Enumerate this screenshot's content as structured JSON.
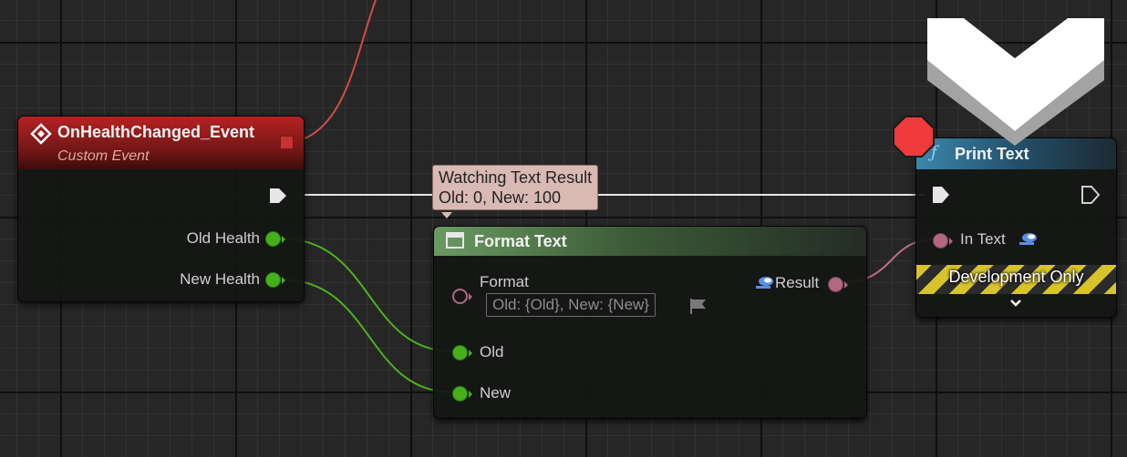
{
  "event_node": {
    "title": "OnHealthChanged_Event",
    "subtitle": "Custom Event",
    "outputs": [
      "Old Health",
      "New Health"
    ],
    "header_color": "#9e1f1f"
  },
  "format_node": {
    "title": "Format Text",
    "format_label": "Format",
    "format_value": "Old: {Old}, New: {New}",
    "result_label": "Result",
    "inputs": [
      "Old",
      "New"
    ],
    "header_color": "#55804e"
  },
  "print_node": {
    "title": "Print Text",
    "in_text_label": "In Text",
    "banner": "Development Only",
    "header_color": "#2f6f8c",
    "function_icon": "ƒ"
  },
  "watch_tooltip": {
    "title": "Watching Text Result",
    "value": "Old: 0, New: 100"
  },
  "icons": {
    "event": "diamond-event-icon",
    "breakpoint": "stop-octagon-icon",
    "execution_indicator": "chevron-down-arrow-icon",
    "expand": "chevron-down-icon",
    "localize": "flag-icon"
  },
  "colors": {
    "exec_wire": "#e6e6e6",
    "int_wire": "#4db01c",
    "text_wire": "#c06b87",
    "breakpoint": "#ef3b3b"
  }
}
